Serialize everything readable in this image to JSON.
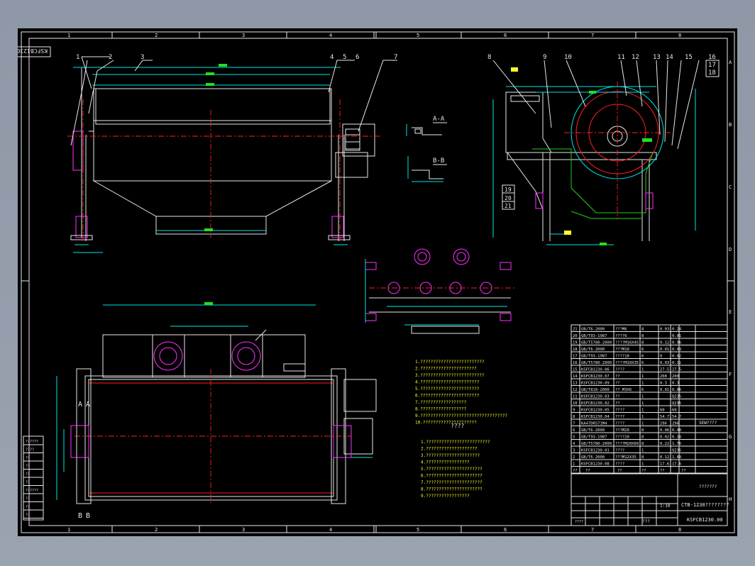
{
  "drawing": {
    "code_title": "KSFCB1230.00",
    "code_bottom": "KSFCB1230.00",
    "title_line": "CTB-1230????????",
    "zone_cols": [
      "1",
      "2",
      "3",
      "4",
      "5",
      "6",
      "7",
      "8"
    ],
    "zone_rows": [
      "A",
      "B",
      "C",
      "D",
      "E",
      "F",
      "G",
      "H"
    ],
    "balloons_front": [
      "1",
      "2",
      "3",
      "4",
      "5",
      "6",
      "7"
    ],
    "balloons_side": [
      "8",
      "9",
      "10",
      "11",
      "12",
      "13",
      "14",
      "15",
      "16",
      "17",
      "18"
    ],
    "balloons_side_low": [
      "19",
      "20",
      "21"
    ],
    "section_aa": "A-A",
    "section_bb": "B-B",
    "marks_plan": [
      "A",
      "A",
      "B",
      "B"
    ],
    "question": "????"
  },
  "notes": {
    "technical": [
      "1.?????????????????????????",
      "2.??????????????????????",
      "3.?????????????????????????",
      "4.???????????????????????",
      "5.???????????????????????",
      "6.???????????????????????",
      "7.??????????????????",
      "8.??????????????????",
      "9.??????????????????????????????????",
      "10.?????????????????????"
    ],
    "performance_title": "????",
    "performance": [
      "1.?????????????????????????",
      "2.????????????????????",
      "3.?????????????????????",
      "4.?????????????????",
      "5.??????????????????????",
      "6.??????????????????????",
      "7.??????????????????????",
      "8.??????????????????????",
      "9.?????????????????"
    ]
  },
  "bom": [
    [
      "21",
      "GB/T6-2000",
      "???M6",
      "8",
      "0.03",
      "0.24"
    ],
    [
      "20",
      "GB/T93-1987",
      "????6",
      "8",
      "",
      "0.01"
    ],
    [
      "19",
      "GB/T5780-2000",
      "????M16X45",
      "8",
      "0.12",
      "0.96"
    ],
    [
      "18",
      "GB/T6-2000",
      "???M10",
      "6",
      "0.01",
      "0.03"
    ],
    [
      "17",
      "GB/T93-1987",
      "????10",
      "6",
      "0",
      "0.02"
    ],
    [
      "16",
      "GB/T5780-2000",
      "????M10X35",
      "6",
      "0.03",
      "0.11"
    ],
    [
      "15",
      "KSFCB1230.06",
      "????",
      "1",
      "27.5",
      "27.5"
    ],
    [
      "14",
      "KSFCB1230.07",
      "??",
      "1",
      "200",
      "200"
    ],
    [
      "13",
      "KSFCB1230.09",
      "??",
      "1",
      "0.3",
      "0.3"
    ],
    [
      "12",
      "GB/T818-2000",
      "?? M3X6",
      "6",
      "0.01",
      "0.06"
    ],
    [
      "11",
      "KSFCB1230.03",
      "??",
      "1",
      "",
      "Q235"
    ],
    [
      "10",
      "KSFCB1230.02",
      "??",
      "1",
      "",
      "Q235"
    ],
    [
      "9",
      "KSFCB1230.05",
      "????",
      "1",
      "60",
      "60"
    ],
    [
      "8",
      "KSFCB1230.04",
      "????",
      "1",
      "54.7",
      "54.7"
    ],
    [
      "7",
      "KA47DRS71M4",
      "????",
      "1",
      "296",
      "296"
    ],
    [
      "6",
      "GB/T6-2000",
      "???M20",
      "8",
      "0.06",
      "0.48"
    ],
    [
      "5",
      "GB/T93-1987",
      "????20",
      "8",
      "0.02",
      "0.18"
    ],
    [
      "4",
      "GB/T5780-2000",
      "????M20X60",
      "8",
      "0.22",
      "1.76"
    ],
    [
      "3",
      "KSFCB1230.01",
      "????",
      "1",
      "",
      "Q235"
    ],
    [
      "2",
      "GB/T6-2000",
      "???M12X35",
      "8",
      "0.12",
      "1.69"
    ],
    [
      "1",
      "KSFCB1230.08",
      "????",
      "1",
      "17.6",
      "17.6"
    ]
  ],
  "bom_extra": "SEW????",
  "bom_header": [
    "??",
    "??",
    "??",
    "??",
    "??",
    "??"
  ],
  "title_block": {
    "name": "CTB-1230????????",
    "code": "KSFCB1230.00",
    "company": "???????",
    "scale": "1:10",
    "sheet": "???",
    "drawer": "????"
  },
  "left_stamp": [
    "??????",
    "????",
    "??",
    "??",
    "??",
    "??",
    "??????",
    "??",
    "??",
    "??"
  ]
}
